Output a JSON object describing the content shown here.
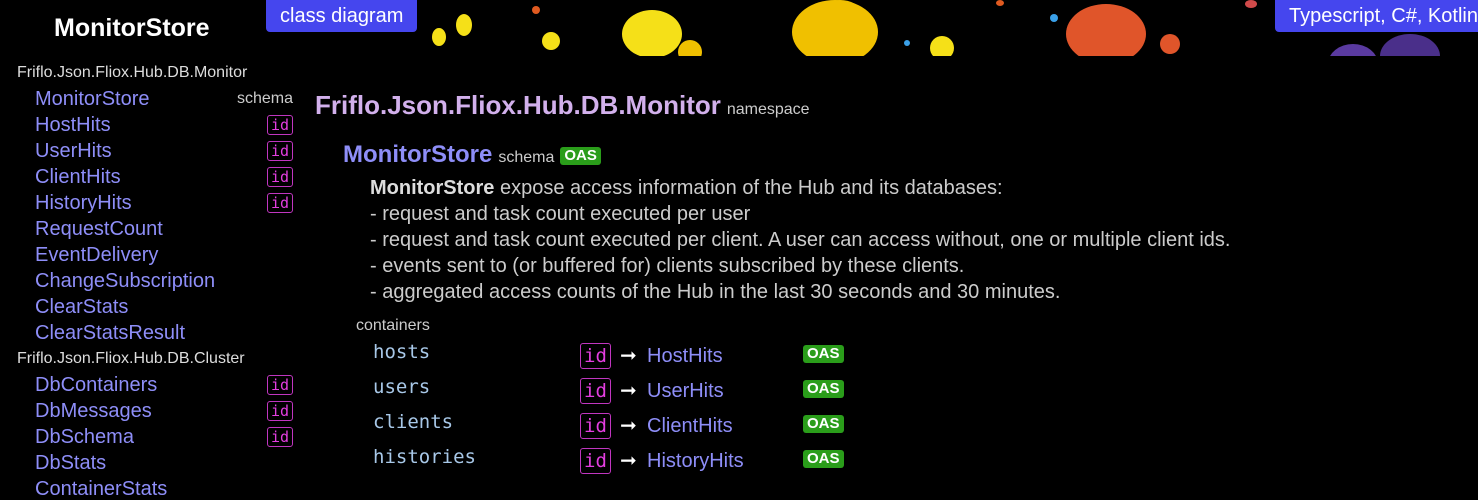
{
  "app": {
    "title": "MonitorStore"
  },
  "header": {
    "left_button": "class diagram",
    "right_button": "Typescript, C#, Kotlin"
  },
  "sidebar": {
    "sections": [
      {
        "namespace": "Friflo.Json.Fliox.Hub.DB.Monitor",
        "items": [
          {
            "label": "MonitorStore",
            "tag": "schema"
          },
          {
            "label": "HostHits",
            "tag": "id"
          },
          {
            "label": "UserHits",
            "tag": "id"
          },
          {
            "label": "ClientHits",
            "tag": "id"
          },
          {
            "label": "HistoryHits",
            "tag": "id"
          },
          {
            "label": "RequestCount"
          },
          {
            "label": "EventDelivery"
          },
          {
            "label": "ChangeSubscription"
          },
          {
            "label": "ClearStats"
          },
          {
            "label": "ClearStatsResult"
          }
        ]
      },
      {
        "namespace": "Friflo.Json.Fliox.Hub.DB.Cluster",
        "items": [
          {
            "label": "DbContainers",
            "tag": "id"
          },
          {
            "label": "DbMessages",
            "tag": "id"
          },
          {
            "label": "DbSchema",
            "tag": "id"
          },
          {
            "label": "DbStats"
          },
          {
            "label": "ContainerStats"
          }
        ]
      }
    ]
  },
  "main": {
    "namespace": "Friflo.Json.Fliox.Hub.DB.Monitor",
    "namespace_kind": "namespace",
    "schema_name": "MonitorStore",
    "schema_kind": "schema",
    "oas_label": "OAS",
    "description": {
      "subject": "MonitorStore",
      "lead": " expose access information of the Hub and its databases:",
      "lines": [
        "- request and task count executed per user",
        "- request and task count executed per client. A user can access without, one or multiple client ids.",
        "- events sent to (or buffered for) clients subscribed by these clients.",
        "- aggregated access counts of the Hub in the last 30 seconds and 30 minutes."
      ]
    },
    "containers_label": "containers",
    "id_label": "id",
    "arrow": "➞",
    "containers": [
      {
        "name": "hosts",
        "type": "HostHits"
      },
      {
        "name": "users",
        "type": "UserHits"
      },
      {
        "name": "clients",
        "type": "ClientHits"
      },
      {
        "name": "histories",
        "type": "HistoryHits"
      }
    ]
  },
  "colors": {
    "background": "#000000",
    "button": "#4546ee",
    "link": "#8e8ef8",
    "namespace_title": "#d2b0ec",
    "oas_badge": "#2a9d1a",
    "id_badge": "#e33ee0"
  }
}
